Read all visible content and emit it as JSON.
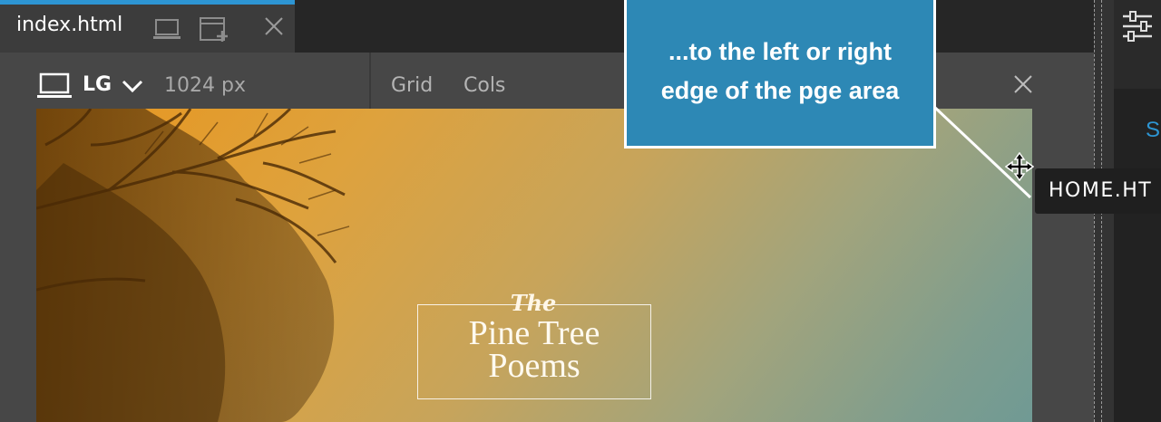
{
  "tab": {
    "title": "index.html",
    "icons": [
      "laptop-icon",
      "duplicate-window-icon",
      "close-icon"
    ]
  },
  "toolbar": {
    "device": "LG",
    "width": "1024 px",
    "grid": "Grid",
    "cols": "Cols"
  },
  "preview": {
    "title_the": "The",
    "title_line1": "Pine Tree",
    "title_line2": "Poems"
  },
  "callout": {
    "line1": "...to the left or right",
    "line2": "edge of the pge area"
  },
  "tooltip": {
    "text": "HOME.HT"
  },
  "right_panel": {
    "letter": "S"
  },
  "colors": {
    "accent": "#2d95d3",
    "callout": "#2d88b5",
    "toolbar": "#474747",
    "tab": "#3c3c3c"
  }
}
